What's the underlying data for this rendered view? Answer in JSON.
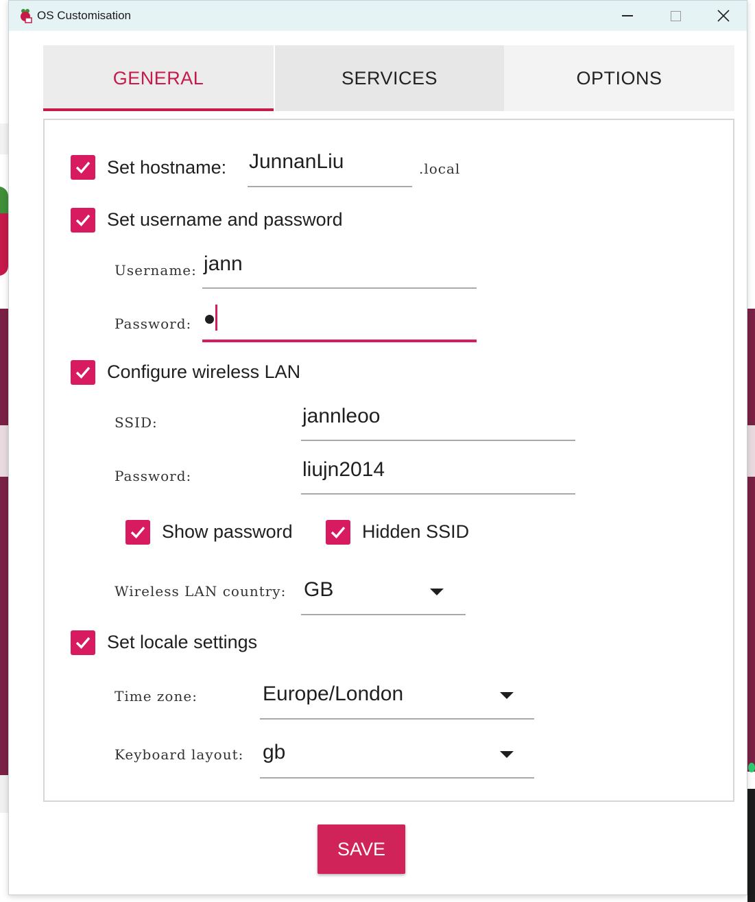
{
  "window": {
    "title": "OS Customisation",
    "icon": "raspberry-pi-icon"
  },
  "tabs": [
    {
      "label": "GENERAL",
      "active": true
    },
    {
      "label": "SERVICES",
      "active": false
    },
    {
      "label": "OPTIONS",
      "active": false
    }
  ],
  "general": {
    "hostname": {
      "label": "Set hostname:",
      "checked": true,
      "value": "JunnanLiu",
      "suffix": ".local"
    },
    "user": {
      "label": "Set username and password",
      "checked": true,
      "username_label": "Username:",
      "username_value": "jann",
      "password_label": "Password:",
      "password_value": "●"
    },
    "wifi": {
      "label": "Configure wireless LAN",
      "checked": true,
      "ssid_label": "SSID:",
      "ssid_value": "jannleoo",
      "password_label": "Password:",
      "password_value": "liujn2014",
      "show_password_label": "Show password",
      "show_password_checked": true,
      "hidden_ssid_label": "Hidden SSID",
      "hidden_ssid_checked": true,
      "country_label": "Wireless LAN country:",
      "country_value": "GB"
    },
    "locale": {
      "label": "Set locale settings",
      "checked": true,
      "timezone_label": "Time zone:",
      "timezone_value": "Europe/London",
      "keyboard_label": "Keyboard layout:",
      "keyboard_value": "gb"
    }
  },
  "actions": {
    "save_label": "SAVE"
  },
  "colors": {
    "accent": "#d81b60",
    "titlebar": "#e6f3f4"
  }
}
